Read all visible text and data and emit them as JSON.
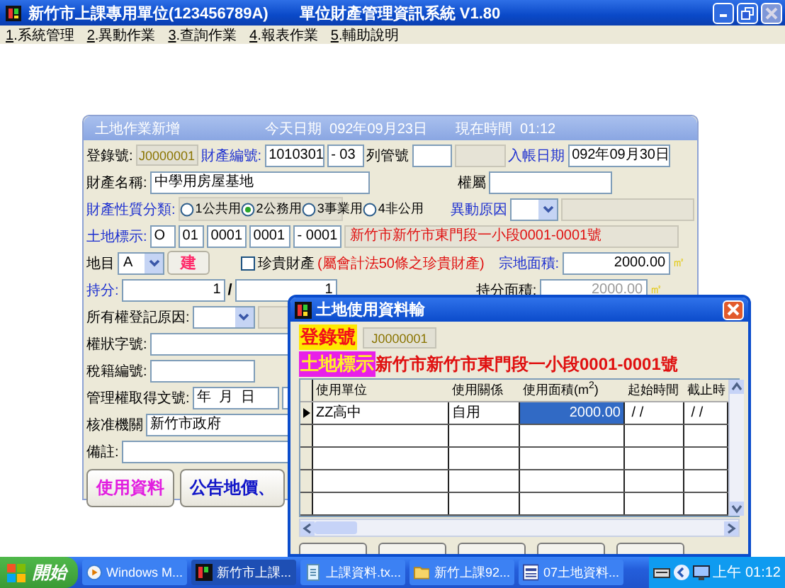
{
  "app_window": {
    "title": "新竹市上課專用單位(123456789A)",
    "subtitle": "單位財產管理資訊系統  V1.80"
  },
  "menu": [
    {
      "label": "1.系統管理"
    },
    {
      "label": "2.異動作業"
    },
    {
      "label": "3.查詢作業"
    },
    {
      "label": "4.報表作業"
    },
    {
      "label": "5.輔助說明"
    }
  ],
  "form_window": {
    "title": "土地作業新增",
    "today": "今天日期  092年09月23日",
    "time": "現在時間  01:12",
    "rows": [
      {
        "items": [
          {
            "kind": "label",
            "text": "登錄號:",
            "required": false
          },
          {
            "kind": "regno",
            "text": "J0000001"
          },
          {
            "kind": "label",
            "text": "財產編號:",
            "required": true
          },
          {
            "kind": "field",
            "text": "1010301"
          },
          {
            "kind": "field",
            "text": "- 03"
          },
          {
            "kind": "label",
            "text": "列管號",
            "required": false
          },
          {
            "kind": "field"
          },
          {
            "kind": "readonly"
          },
          {
            "kind": "label",
            "text": "入帳日期",
            "required": true
          },
          {
            "kind": "field",
            "text": "092年09月30日"
          }
        ]
      },
      {
        "items": [
          {
            "kind": "label",
            "text": "財產名稱:",
            "required": false
          },
          {
            "kind": "field",
            "text": "中學用房屋基地"
          },
          {
            "kind": "label",
            "text": "權屬",
            "required": false
          },
          {
            "kind": "field"
          }
        ]
      },
      {
        "items": [
          {
            "kind": "label",
            "text": "財產性質分類:",
            "required": true
          },
          {
            "kind": "radios",
            "options": [
              {
                "label": "1公共用",
                "selected": false
              },
              {
                "label": "2公務用",
                "selected": true
              },
              {
                "label": "3事業用",
                "selected": false
              },
              {
                "label": "4非公用",
                "selected": false
              }
            ]
          },
          {
            "kind": "label",
            "text": "異動原因",
            "required": true
          },
          {
            "kind": "dropdown"
          },
          {
            "kind": "readonly"
          }
        ]
      },
      {
        "items": [
          {
            "kind": "label",
            "text": "土地標示:",
            "required": true
          },
          {
            "kind": "field",
            "text": "O"
          },
          {
            "kind": "field",
            "text": "01"
          },
          {
            "kind": "field",
            "text": "0001"
          },
          {
            "kind": "field",
            "text": "0001"
          },
          {
            "kind": "field",
            "text": "- 0001"
          },
          {
            "kind": "readonly-note",
            "text": "新竹市新竹市東門段一小段0001-0001號"
          }
        ]
      },
      {
        "items": [
          {
            "kind": "label",
            "text": "地目",
            "required": false
          },
          {
            "kind": "dropdown",
            "text": "A"
          },
          {
            "kind": "button",
            "text": "建"
          },
          {
            "kind": "checkbox",
            "text": "珍貴財產",
            "checked": false
          },
          {
            "kind": "note",
            "text": "(屬會計法50條之珍貴財產)"
          },
          {
            "kind": "label",
            "text": "宗地面積:",
            "required": true
          },
          {
            "kind": "number",
            "text": "2000.00",
            "disabled": false
          },
          {
            "kind": "unit",
            "text": "㎡"
          }
        ]
      },
      {
        "items": [
          {
            "kind": "label",
            "text": "持分:",
            "required": true
          },
          {
            "kind": "number",
            "text": "1",
            "disabled": false
          },
          {
            "kind": "slash",
            "text": "/"
          },
          {
            "kind": "number",
            "text": "1",
            "disabled": false
          },
          {
            "kind": "label",
            "text": "持分面積:",
            "required": false
          },
          {
            "kind": "number",
            "text": "2000.00",
            "disabled": true
          },
          {
            "kind": "unit",
            "text": "㎡"
          }
        ]
      },
      {
        "items": [
          {
            "kind": "label",
            "text": "所有權登記原因:",
            "required": false
          },
          {
            "kind": "dropdown"
          },
          {
            "kind": "readonly"
          }
        ]
      },
      {
        "items": [
          {
            "kind": "label",
            "text": "權狀字號:",
            "required": false
          },
          {
            "kind": "field"
          }
        ]
      },
      {
        "items": [
          {
            "kind": "label",
            "text": "稅籍編號:",
            "required": false
          },
          {
            "kind": "field"
          }
        ]
      },
      {
        "items": [
          {
            "kind": "label",
            "text": "管理權取得文號:",
            "required": false
          },
          {
            "kind": "field",
            "text": "年  月  日"
          },
          {
            "kind": "field"
          }
        ]
      },
      {
        "items": [
          {
            "kind": "label",
            "text": "核准機關",
            "required": false
          },
          {
            "kind": "field",
            "text": "新竹市政府"
          }
        ]
      },
      {
        "items": [
          {
            "kind": "label",
            "text": "備註:",
            "required": false
          },
          {
            "kind": "field"
          }
        ]
      }
    ],
    "buttons": [
      {
        "label": "使用資料"
      },
      {
        "label": "公告地價、"
      }
    ]
  },
  "dialog": {
    "title": "土地使用資料輸",
    "regno_label": "登錄號",
    "regno": "J0000001",
    "land_label": "土地標示",
    "land_text": "新竹市新竹市東門段一小段0001-0001號",
    "columns": [
      "使用單位",
      "使用關係",
      "使用面積(m$^{2}$)",
      "起始時間",
      "截止時"
    ],
    "rows": [
      {
        "current": true,
        "cells": [
          {
            "text": "ZZ高中",
            "selected": false
          },
          {
            "text": "自用",
            "selected": false
          },
          {
            "text": "2000.00",
            "selected": true
          },
          {
            "text": " / /",
            "selected": false
          },
          {
            "text": " / /",
            "selected": false
          }
        ]
      }
    ]
  },
  "taskbar": {
    "start": "開始",
    "items": [
      {
        "label": "Windows M...",
        "kind": "media",
        "active": false
      },
      {
        "label": "新竹市上課...",
        "kind": "app",
        "active": true
      },
      {
        "label": "上課資料.tx...",
        "kind": "notepad",
        "active": false
      },
      {
        "label": "新竹上課92...",
        "kind": "folder",
        "active": false
      },
      {
        "label": "07土地資料...",
        "kind": "doc",
        "active": false
      }
    ],
    "clock": "上午 01:12"
  }
}
